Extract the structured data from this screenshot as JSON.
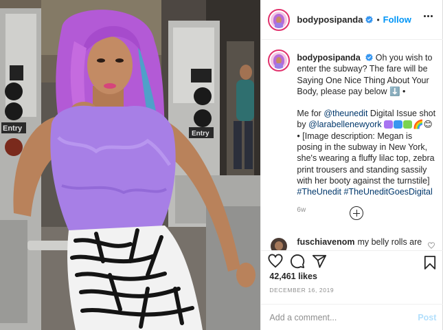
{
  "header": {
    "username": "bodyposipanda",
    "separator": "•",
    "follow_label": "Follow"
  },
  "caption": {
    "username": "bodyposipanda",
    "text_1": "Oh you wish to enter the subway? The fare will be Saying One Nice Thing About Your Body, please pay below ⬇️ •",
    "text_2a": "Me for ",
    "mention_1": "@theunedit",
    "text_2b": " Digital Issue shot by ",
    "mention_2": "@larabellenewyork",
    "text_2c": "🌈😊 •",
    "text_3": "[Image description: Megan is posing in the subway in New York, she's wearing a fluffy lilac top, zebra print trousers and standing sassily with her booty against the turnstile]",
    "hashtag_1": "#TheUnedit",
    "hashtag_2": "#TheUneditGoesDigital",
    "age": "6w",
    "emoji_colors": [
      "#a774f2",
      "#3897f0",
      "#7bd34f"
    ]
  },
  "comment": {
    "username": "fuschiavenom",
    "text": "my belly rolls are"
  },
  "actions": {
    "likes": "42,461 likes",
    "date": "DECEMBER 16, 2019"
  },
  "add_comment": {
    "placeholder": "Add a comment...",
    "post_label": "Post"
  },
  "photo": {
    "turnstile_label_left": "Entry",
    "turnstile_label_right": "Entry"
  },
  "colors": {
    "accent": "#0095f6",
    "mention": "#00376b",
    "secondary_text": "#8e8e8e",
    "post_disabled": "#b2dffc",
    "story_ring": "#e1306c"
  }
}
